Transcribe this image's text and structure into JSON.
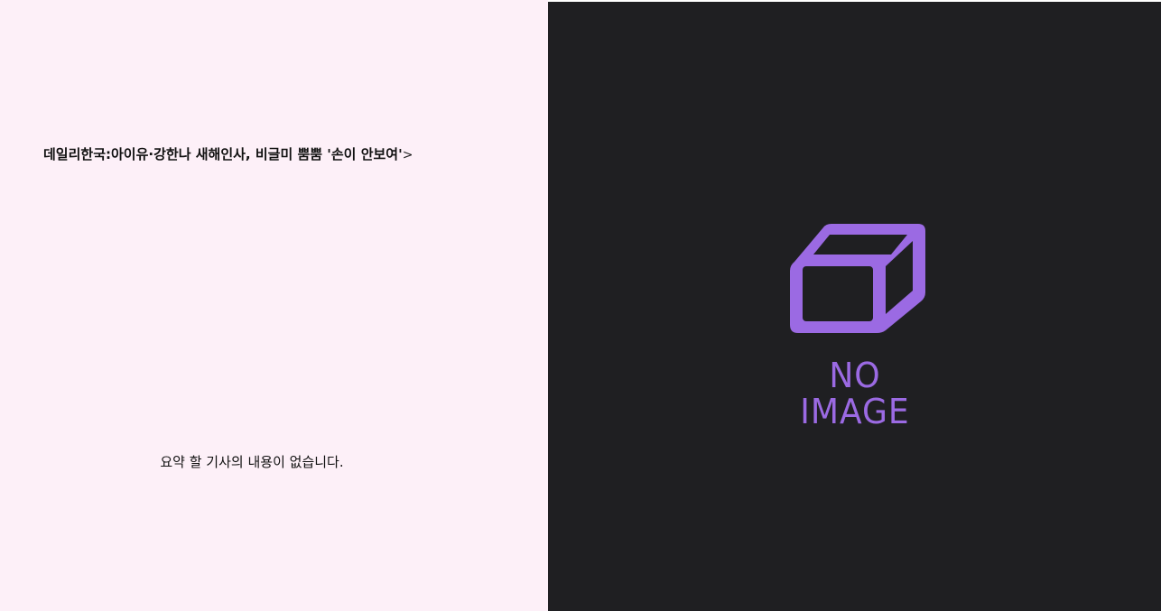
{
  "article": {
    "headline": "데일리한국:아이유·강한나 새해인사, 비글미 뿜뿜 '손이 안보여'",
    "headline_arrow": ">",
    "summary": "요약 할 기사의 내용이 없습니다."
  },
  "image_placeholder": {
    "icon": "box-icon",
    "label": "NO IMAGE",
    "accent_color": "#9b6ae3",
    "background_color": "#1f1f22"
  },
  "colors": {
    "left_panel_background": "#fdf0f8"
  }
}
